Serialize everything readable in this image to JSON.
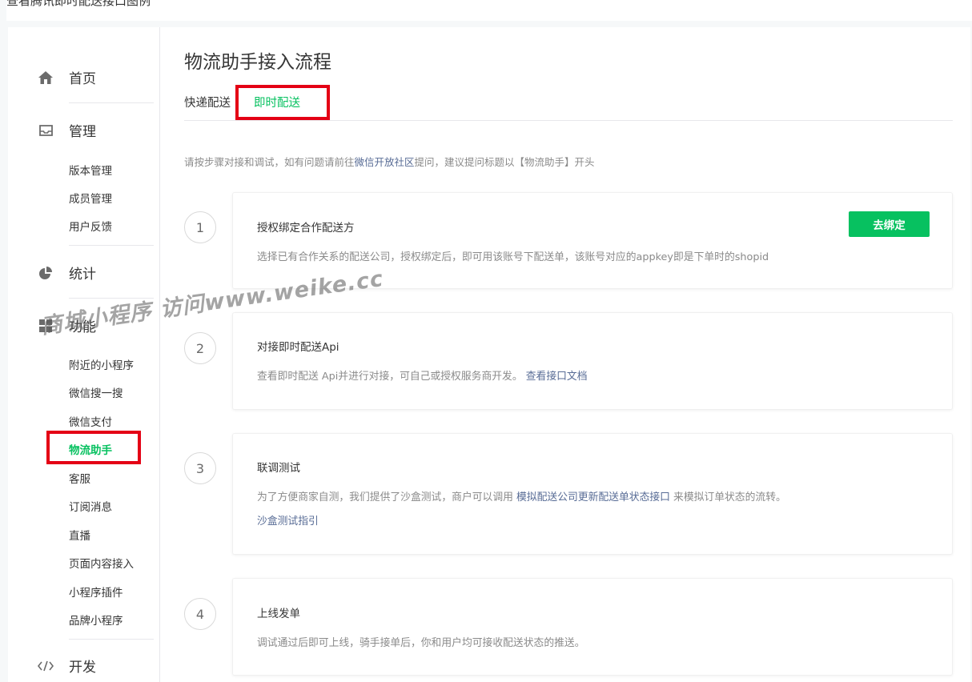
{
  "caption": "查看腾讯即时配送接口图例",
  "sidebar": {
    "home": "首页",
    "manage": "管理",
    "manage_items": [
      "版本管理",
      "成员管理",
      "用户反馈"
    ],
    "stats": "统计",
    "features": "功能",
    "feature_items": [
      "附近的小程序",
      "微信搜一搜",
      "微信支付",
      "物流助手",
      "客服",
      "订阅消息",
      "直播",
      "页面内容接入",
      "小程序插件",
      "品牌小程序"
    ],
    "dev": "开发",
    "active_item": "物流助手"
  },
  "main": {
    "title": "物流助手接入流程",
    "tabs": [
      "快递配送",
      "即时配送"
    ],
    "active_tab": "即时配送",
    "tip_prefix": "请按步骤对接和调试，如有问题请前往",
    "tip_link": "微信开放社区",
    "tip_suffix": "提问，建议提问标题以【物流助手】开头",
    "steps": [
      {
        "num": "1",
        "title": "授权绑定合作配送方",
        "desc": "选择已有合作关系的配送公司，授权绑定后，即可用该账号下配送单，该账号对应的appkey即是下单时的shopid",
        "button": "去绑定"
      },
      {
        "num": "2",
        "title": "对接即时配送Api",
        "desc": "查看即时配送 Api并进行对接，可自己或授权服务商开发。",
        "link": "查看接口文档"
      },
      {
        "num": "3",
        "title": "联调测试",
        "desc_prefix": "为了方便商家自测，我们提供了沙盒测试，商户可以调用 ",
        "desc_link": "模拟配送公司更新配送单状态接口",
        "desc_suffix": " 来模拟订单状态的流转。",
        "link": "沙盒测试指引"
      },
      {
        "num": "4",
        "title": "上线发单",
        "desc": "调试通过后即可上线，骑手接单后，你和用户均可接收配送状态的推送。"
      }
    ]
  },
  "watermark": "商城小程序 访问www.weike.cc",
  "colors": {
    "accent": "#07c160",
    "link": "#576b95",
    "highlight": "#e40015"
  }
}
